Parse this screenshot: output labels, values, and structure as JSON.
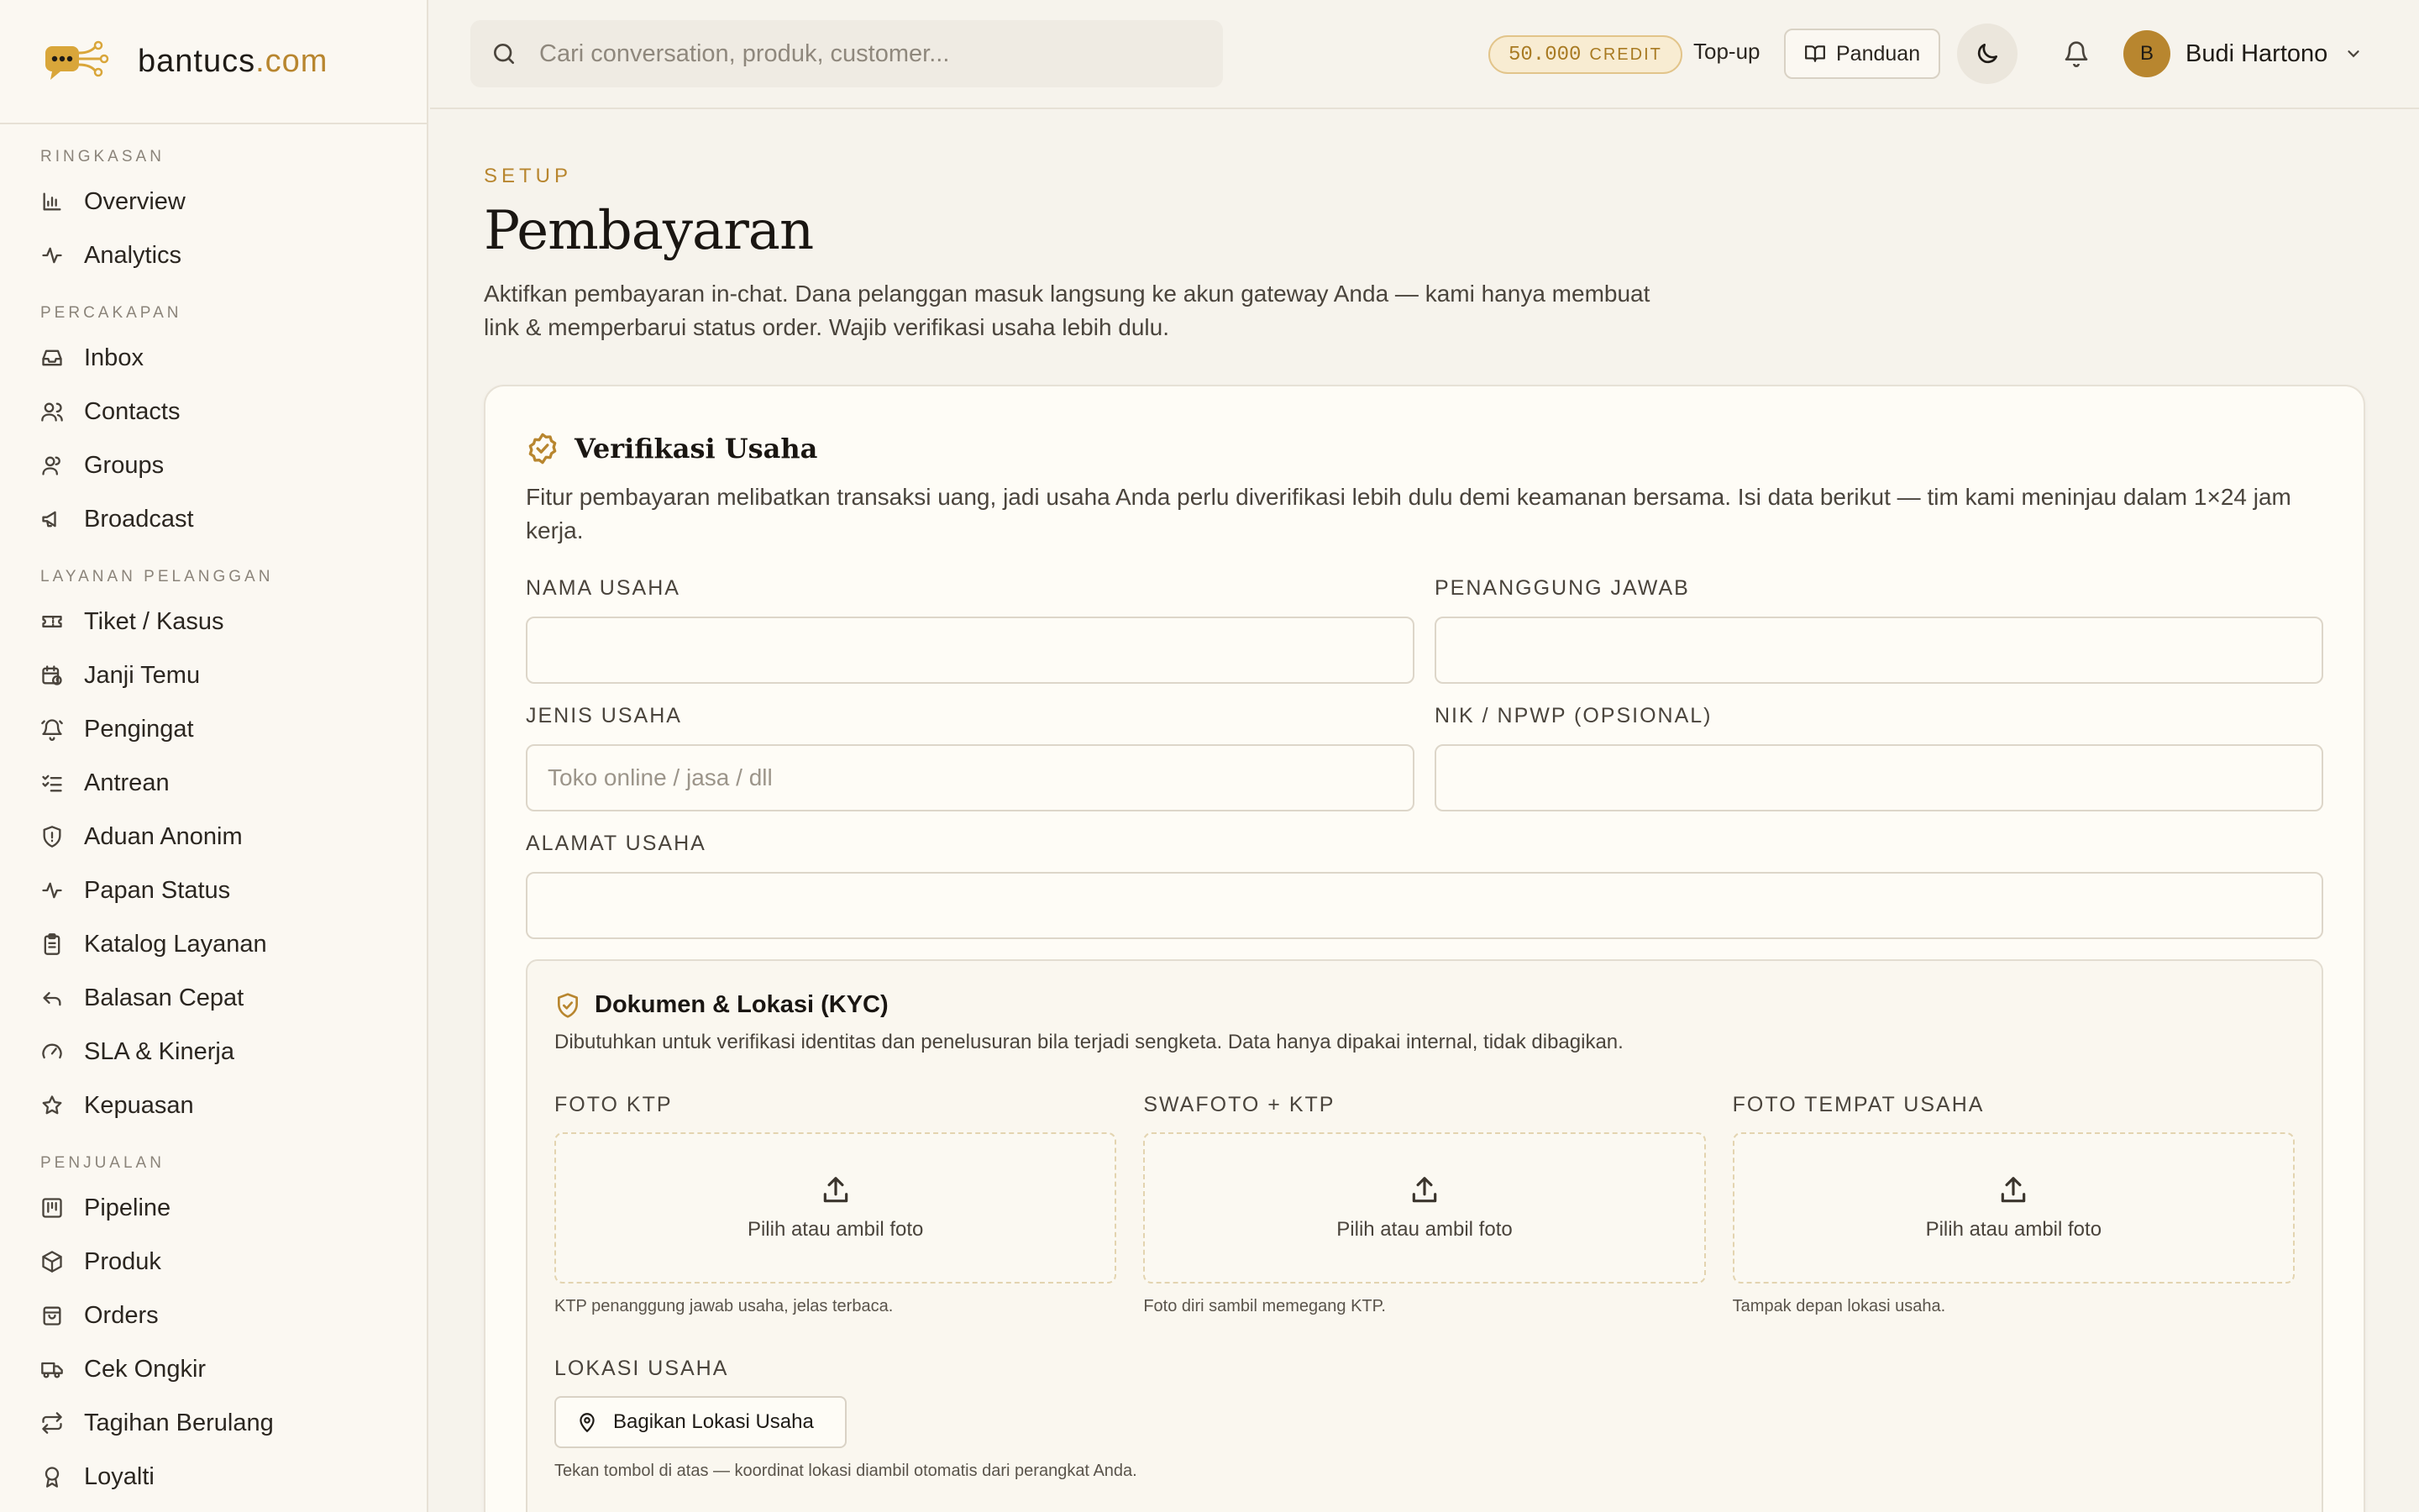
{
  "brand": {
    "name": "bantucs",
    "tld": ".com"
  },
  "sidebar": {
    "sections": [
      {
        "title": "RINGKASAN",
        "items": [
          {
            "label": "Overview",
            "icon": "bar-chart-icon"
          },
          {
            "label": "Analytics",
            "icon": "activity-icon"
          }
        ]
      },
      {
        "title": "PERCAKAPAN",
        "items": [
          {
            "label": "Inbox",
            "icon": "inbox-icon"
          },
          {
            "label": "Contacts",
            "icon": "users-icon"
          },
          {
            "label": "Groups",
            "icon": "user-group-icon"
          },
          {
            "label": "Broadcast",
            "icon": "megaphone-icon"
          }
        ]
      },
      {
        "title": "LAYANAN PELANGGAN",
        "items": [
          {
            "label": "Tiket / Kasus",
            "icon": "ticket-icon"
          },
          {
            "label": "Janji Temu",
            "icon": "calendar-clock-icon"
          },
          {
            "label": "Pengingat",
            "icon": "bell-ring-icon"
          },
          {
            "label": "Antrean",
            "icon": "list-checks-icon"
          },
          {
            "label": "Aduan Anonim",
            "icon": "shield-icon"
          },
          {
            "label": "Papan Status",
            "icon": "activity-icon"
          },
          {
            "label": "Katalog Layanan",
            "icon": "clipboard-icon"
          },
          {
            "label": "Balasan Cepat",
            "icon": "reply-icon"
          },
          {
            "label": "SLA & Kinerja",
            "icon": "gauge-icon"
          },
          {
            "label": "Kepuasan",
            "icon": "star-icon"
          }
        ]
      },
      {
        "title": "PENJUALAN",
        "items": [
          {
            "label": "Pipeline",
            "icon": "kanban-icon"
          },
          {
            "label": "Produk",
            "icon": "package-icon"
          },
          {
            "label": "Orders",
            "icon": "shopping-bag-icon"
          },
          {
            "label": "Cek Ongkir",
            "icon": "truck-icon"
          },
          {
            "label": "Tagihan Berulang",
            "icon": "repeat-icon"
          },
          {
            "label": "Loyalti",
            "icon": "award-icon"
          }
        ]
      }
    ]
  },
  "topbar": {
    "search_placeholder": "Cari conversation, produk, customer...",
    "credit_amount": "50.000",
    "credit_unit": "CREDIT",
    "topup_label": "Top-up",
    "guide_label": "Panduan",
    "user_initial": "B",
    "user_name": "Budi Hartono"
  },
  "page": {
    "eyebrow": "SETUP",
    "title": "Pembayaran",
    "description": "Aktifkan pembayaran in-chat. Dana pelanggan masuk langsung ke akun gateway Anda — kami hanya membuat link & memperbarui status order. Wajib verifikasi usaha lebih dulu."
  },
  "verification": {
    "title": "Verifikasi Usaha",
    "description": "Fitur pembayaran melibatkan transaksi uang, jadi usaha Anda perlu diverifikasi lebih dulu demi keamanan bersama. Isi data berikut — tim kami meninjau dalam 1×24 jam kerja.",
    "fields": {
      "business_name": {
        "label": "NAMA USAHA",
        "value": "",
        "placeholder": ""
      },
      "person_in_charge": {
        "label": "PENANGGUNG JAWAB",
        "value": "",
        "placeholder": ""
      },
      "business_type": {
        "label": "JENIS USAHA",
        "value": "",
        "placeholder": "Toko online / jasa / dll"
      },
      "nik_npwp": {
        "label": "NIK / NPWP (OPSIONAL)",
        "value": "",
        "placeholder": ""
      },
      "business_address": {
        "label": "ALAMAT USAHA",
        "value": "",
        "placeholder": ""
      }
    },
    "kyc": {
      "title": "Dokumen & Lokasi (KYC)",
      "description": "Dibutuhkan untuk verifikasi identitas dan penelusuran bila terjadi sengketa. Data hanya dipakai internal, tidak dibagikan.",
      "uploads": [
        {
          "label": "FOTO KTP",
          "action": "Pilih atau ambil foto",
          "hint": "KTP penanggung jawab usaha, jelas terbaca."
        },
        {
          "label": "SWAFOTO + KTP",
          "action": "Pilih atau ambil foto",
          "hint": "Foto diri sambil memegang KTP."
        },
        {
          "label": "FOTO TEMPAT USAHA",
          "action": "Pilih atau ambil foto",
          "hint": "Tampak depan lokasi usaha."
        }
      ],
      "location_label": "LOKASI USAHA",
      "location_button": "Bagikan Lokasi Usaha",
      "location_hint": "Tekan tombol di atas — koordinat lokasi diambil otomatis dari perangkat Anda."
    }
  },
  "colors": {
    "accent": "#b8862f",
    "background": "#f6f3ec",
    "card": "#fefcf6"
  }
}
